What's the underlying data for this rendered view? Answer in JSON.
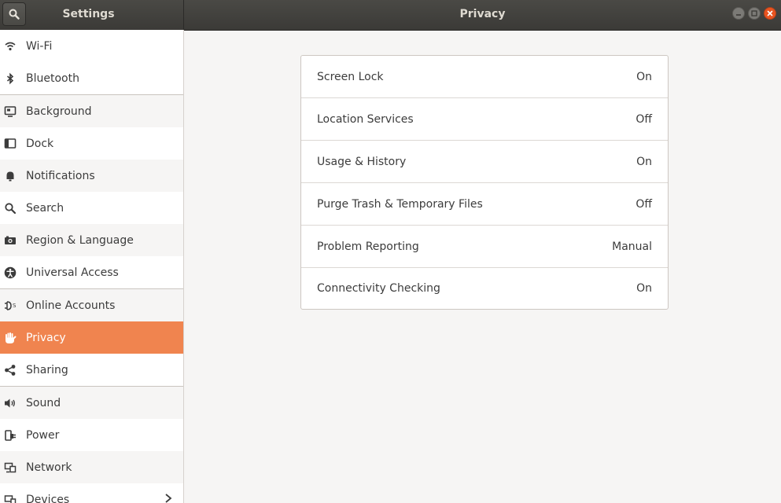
{
  "header": {
    "left_title": "Settings",
    "title": "Privacy"
  },
  "sidebar": {
    "items": [
      {
        "label": "Wi-Fi",
        "icon": "wifi-icon"
      },
      {
        "label": "Bluetooth",
        "icon": "bluetooth-icon"
      },
      {
        "label": "Background",
        "icon": "background-icon"
      },
      {
        "label": "Dock",
        "icon": "dock-icon"
      },
      {
        "label": "Notifications",
        "icon": "bell-icon"
      },
      {
        "label": "Search",
        "icon": "search-icon"
      },
      {
        "label": "Region & Language",
        "icon": "camera-icon"
      },
      {
        "label": "Universal Access",
        "icon": "accessibility-icon"
      },
      {
        "label": "Online Accounts",
        "icon": "online-accounts-icon"
      },
      {
        "label": "Privacy",
        "icon": "hand-icon"
      },
      {
        "label": "Sharing",
        "icon": "share-icon"
      },
      {
        "label": "Sound",
        "icon": "speaker-icon"
      },
      {
        "label": "Power",
        "icon": "power-plug-icon"
      },
      {
        "label": "Network",
        "icon": "network-icon"
      },
      {
        "label": "Devices",
        "icon": "devices-icon"
      }
    ],
    "selected": "Privacy"
  },
  "privacy": {
    "rows": [
      {
        "label": "Screen Lock",
        "value": "On"
      },
      {
        "label": "Location Services",
        "value": "Off"
      },
      {
        "label": "Usage & History",
        "value": "On"
      },
      {
        "label": "Purge Trash & Temporary Files",
        "value": "Off"
      },
      {
        "label": "Problem Reporting",
        "value": "Manual"
      },
      {
        "label": "Connectivity Checking",
        "value": "On"
      }
    ]
  },
  "colors": {
    "accent": "#f0844f",
    "close": "#e95420",
    "header": "#3b3a37"
  }
}
